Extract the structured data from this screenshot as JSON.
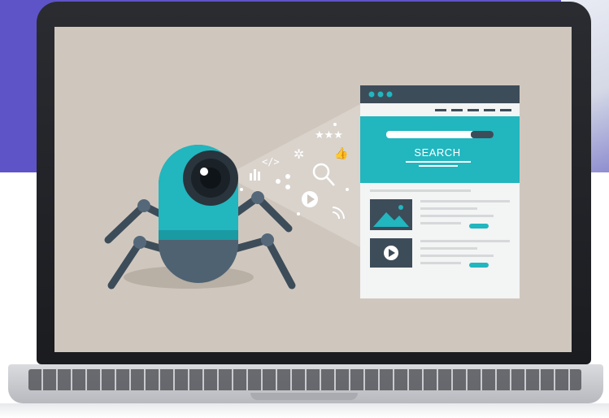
{
  "scene": {
    "description_label": "",
    "browser": {
      "search_label": "SEARCH"
    }
  },
  "colors": {
    "teal": "#22b6bf",
    "dark_slate": "#3d4c59",
    "screen_bg": "#cfc7be",
    "purple_bg": "#5e54c8"
  },
  "icons": [
    "robot-spider-icon",
    "camera-eye-icon",
    "stars-icon",
    "code-icon",
    "gear-icon",
    "thumbs-up-icon",
    "chart-icon",
    "share-icon",
    "magnifier-icon",
    "play-icon",
    "rss-icon",
    "image-icon",
    "video-icon"
  ]
}
